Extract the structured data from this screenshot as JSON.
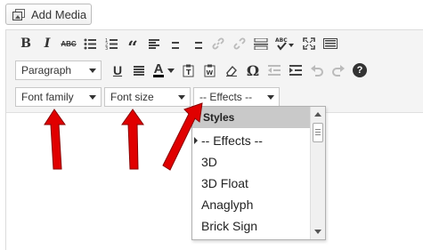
{
  "add_media": {
    "label": "Add Media",
    "icon": "media-icon"
  },
  "toolbar": {
    "row1": [
      {
        "name": "bold-button",
        "glyph": "B"
      },
      {
        "name": "italic-button",
        "glyph": "I"
      },
      {
        "name": "strikethrough-button",
        "glyph": "ABC"
      },
      {
        "name": "bullet-list-button",
        "glyph": ""
      },
      {
        "name": "numbered-list-button",
        "glyph": ""
      },
      {
        "name": "blockquote-button",
        "glyph": "“"
      },
      {
        "name": "align-left-button",
        "glyph": ""
      },
      {
        "name": "align-center-button",
        "glyph": ""
      },
      {
        "name": "align-right-button",
        "glyph": ""
      },
      {
        "name": "insert-link-button",
        "glyph": ""
      },
      {
        "name": "unlink-button",
        "glyph": ""
      },
      {
        "name": "read-more-button",
        "glyph": ""
      },
      {
        "name": "spellcheck-button",
        "glyph": "ABC"
      },
      {
        "name": "fullscreen-button",
        "glyph": ""
      },
      {
        "name": "toolbar-toggle-button",
        "glyph": ""
      }
    ],
    "row2": {
      "format_select": "Paragraph",
      "omega": "Ω",
      "help": "?",
      "underline": "U",
      "font_color": "A"
    },
    "row3": {
      "font_family": "Font family",
      "font_size": "Font size",
      "effects": "-- Effects --"
    }
  },
  "dropdown": {
    "header": "Styles",
    "items": [
      "-- Effects --",
      "3D",
      "3D Float",
      "Anaglyph",
      "Brick Sign"
    ],
    "selected_index": 0
  },
  "colors": {
    "arrow": "#e00000",
    "toolbar_bg": "#f4f4f4",
    "dropdown_header": "#c9c9c9"
  }
}
